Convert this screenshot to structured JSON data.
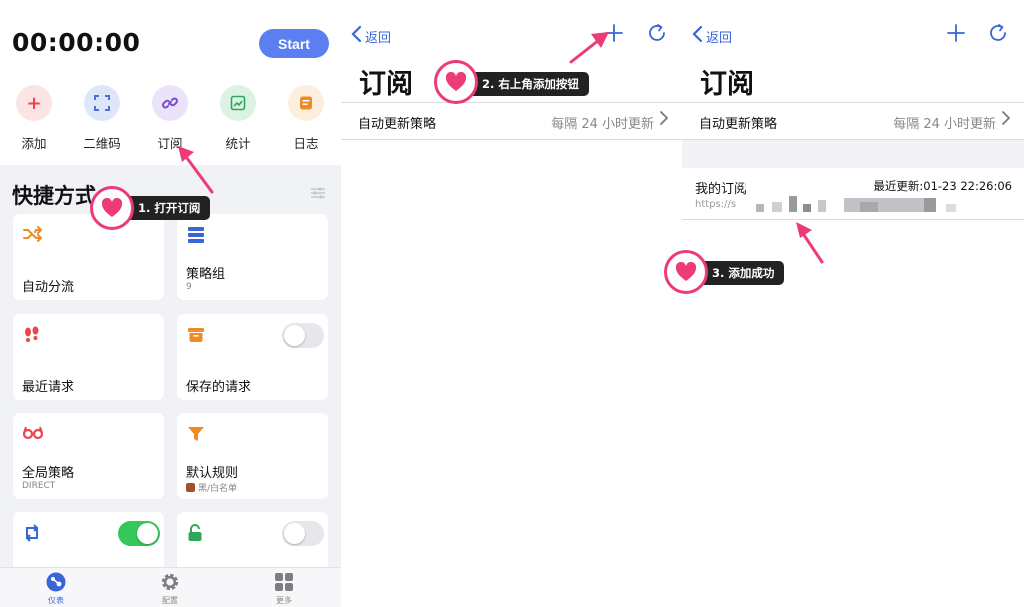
{
  "panel1": {
    "timer": "00:00:00",
    "start_label": "Start",
    "quick_actions": [
      {
        "label": "添加",
        "icon": "plus-icon",
        "color": "#e8484d",
        "bg": "#fde4e4"
      },
      {
        "label": "二维码",
        "icon": "scan-icon",
        "color": "#4a6fd6",
        "bg": "#dee6fa"
      },
      {
        "label": "订阅",
        "icon": "link-icon",
        "color": "#7a4fd8",
        "bg": "#ebe3fa"
      },
      {
        "label": "统计",
        "icon": "chart-icon",
        "color": "#2fa65a",
        "bg": "#dcf3e3"
      },
      {
        "label": "日志",
        "icon": "log-icon",
        "color": "#f08a24",
        "bg": "#fdeedd"
      }
    ],
    "section_title": "快捷方式",
    "cards": [
      {
        "title": "自动分流",
        "sub": "",
        "icon": "shuffle-icon",
        "color": "#f08a24"
      },
      {
        "title": "策略组",
        "sub": "9",
        "icon": "stack-icon",
        "color": "#3866d8"
      },
      {
        "title": "最近请求",
        "sub": "",
        "icon": "footprint-icon",
        "color": "#e8484d"
      },
      {
        "title": "保存的请求",
        "sub": "",
        "icon": "box-icon",
        "color": "#f08a24"
      },
      {
        "title": "全局策略",
        "sub": "DIRECT",
        "icon": "glasses-icon",
        "color": "#e8484d"
      },
      {
        "title": "默认规则",
        "sub": "黑/白名单",
        "icon": "filter-icon",
        "color": "#f08a24"
      },
      {
        "title": "",
        "sub": "",
        "icon": "sync-icon",
        "color": "#3866d8"
      },
      {
        "title": "",
        "sub": "",
        "icon": "lock-open-icon",
        "color": "#2fa65a"
      }
    ],
    "tabs": [
      {
        "label": "仪表",
        "icon": "dashboard-icon",
        "active": true
      },
      {
        "label": "配置",
        "icon": "gear-icon",
        "active": false
      },
      {
        "label": "更多",
        "icon": "grid-icon",
        "active": false
      }
    ]
  },
  "nav": {
    "back_label": "返回"
  },
  "panel2": {
    "title": "订阅",
    "row_left": "自动更新策略",
    "row_right": "每隔 24 小时更新"
  },
  "panel3": {
    "title": "订阅",
    "row_left": "自动更新策略",
    "row_right": "每隔 24 小时更新",
    "sub_name": "我的订阅",
    "sub_updated": "最近更新:01-23 22:26:06",
    "sub_url": "https://s"
  },
  "callouts": {
    "step1": "1. 打开订阅",
    "step2": "2. 右上角添加按钮",
    "step3": "3. 添加成功"
  },
  "colors": {
    "accent": "#3866d8",
    "start": "#5b7ff0",
    "callout": "#ec3b77",
    "toggle_on": "#35c759"
  }
}
